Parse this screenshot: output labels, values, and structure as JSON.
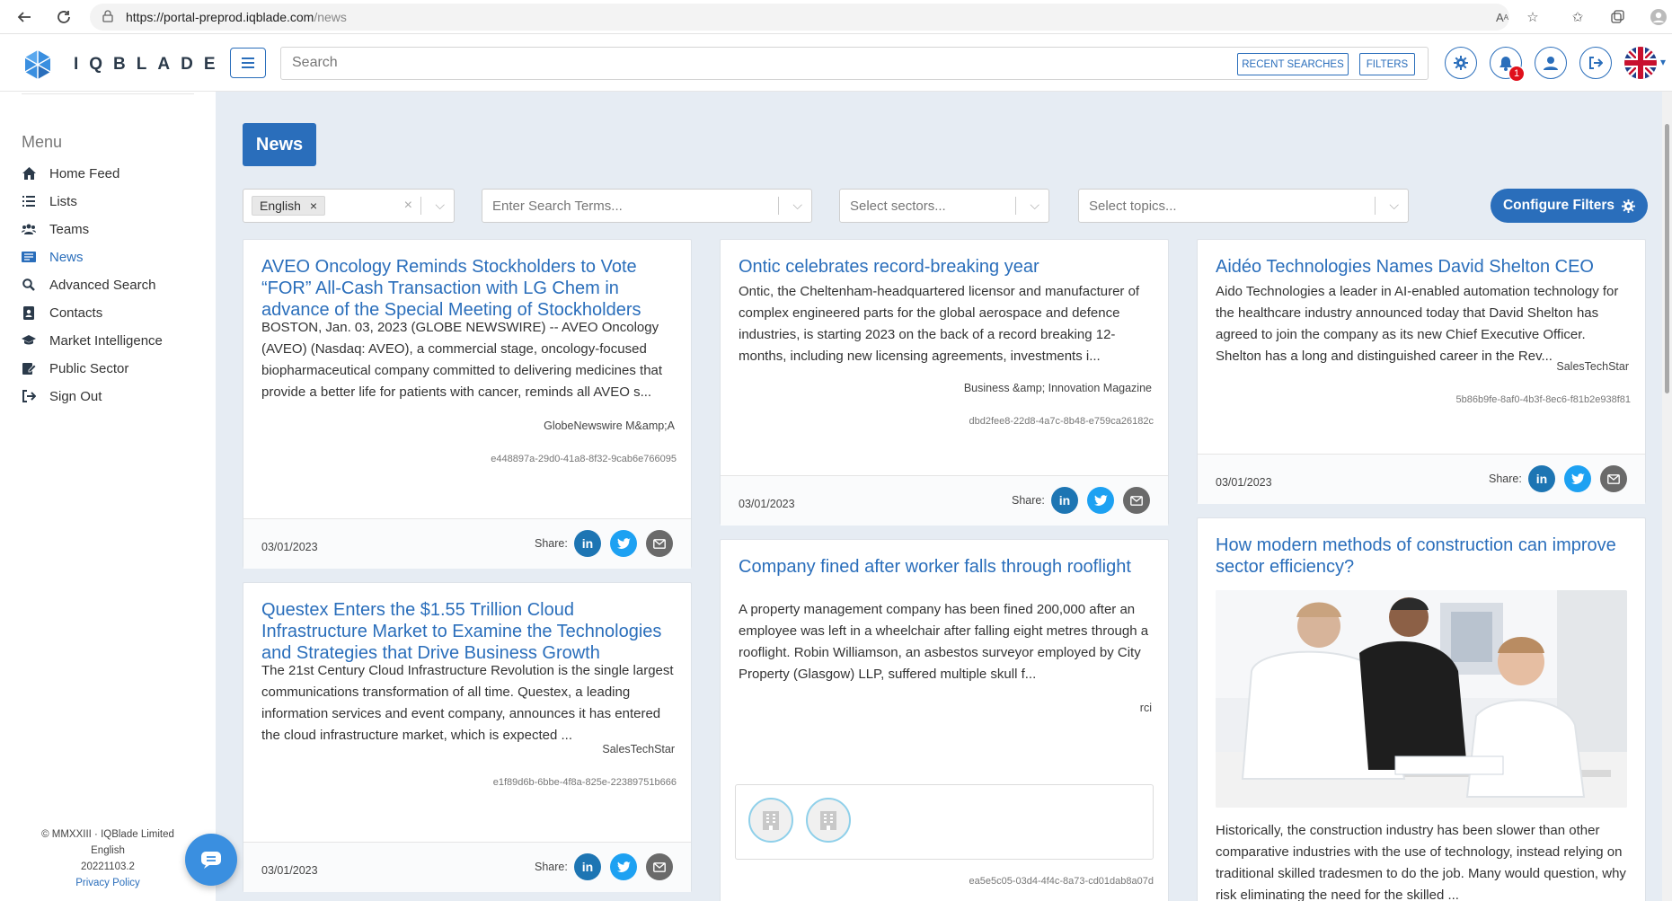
{
  "browser": {
    "url_host": "https://portal-preprod.iqblade.com",
    "url_path": "/news"
  },
  "header": {
    "logo_text": "IQBLADE",
    "search_placeholder": "Search",
    "recent_searches_label": "RECENT SEARCHES",
    "filters_label": "FILTERS",
    "notification_count": "1",
    "icons": [
      "settings-icon",
      "bell-icon",
      "user-icon",
      "sign-out-icon",
      "uk-flag-icon"
    ]
  },
  "sidebar": {
    "menu_heading": "Menu",
    "items": [
      {
        "label": "Home Feed",
        "icon": "home-icon"
      },
      {
        "label": "Lists",
        "icon": "list-icon"
      },
      {
        "label": "Teams",
        "icon": "users-icon"
      },
      {
        "label": "News",
        "icon": "news-icon",
        "active": true
      },
      {
        "label": "Advanced Search",
        "icon": "search-icon"
      },
      {
        "label": "Contacts",
        "icon": "contact-book-icon"
      },
      {
        "label": "Market Intelligence",
        "icon": "graduation-cap-icon"
      },
      {
        "label": "Public Sector",
        "icon": "edit-doc-icon"
      },
      {
        "label": "Sign Out",
        "icon": "sign-out-icon"
      }
    ],
    "footer": {
      "copyright": "© MMXXIII · IQBlade Limited",
      "language": "English",
      "version": "20221103.2",
      "privacy": "Privacy Policy"
    }
  },
  "main": {
    "title": "News",
    "filters": {
      "language_tag": "English",
      "search_terms_placeholder": "Enter Search Terms...",
      "sectors_placeholder": "Select sectors...",
      "topics_placeholder": "Select topics..."
    },
    "configure_filters_label": "Configure Filters",
    "share_label": "Share:",
    "articles": [
      {
        "title": "AVEO Oncology Reminds Stockholders to Vote “FOR” All-Cash Transaction with LG Chem in advance of the Special Meeting of Stockholders",
        "body": "BOSTON, Jan. 03, 2023 (GLOBE NEWSWIRE) -- AVEO Oncology (AVEO) (Nasdaq: AVEO), a commercial stage, oncology-focused biopharmaceutical company committed to delivering medicines that provide a better life for patients with cancer, reminds all AVEO s...",
        "source": "GlobeNewswire M&amp;A",
        "id": "e448897a-29d0-41a8-8f32-9cab6e766095",
        "date": "03/01/2023"
      },
      {
        "title": "Questex Enters the $1.55 Trillion Cloud Infrastructure Market to Examine the Technologies and Strategies that Drive Business Growth",
        "body": "The 21st Century Cloud Infrastructure Revolution is the single largest communications transformation of all time. Questex, a leading information services and event company, announces it has entered the cloud infrastructure market, which is expected ...",
        "source": "SalesTechStar",
        "id": "e1f89d6b-6bbe-4f8a-825e-22389751b666",
        "date": "03/01/2023"
      },
      {
        "title": "Ontic celebrates record-breaking year",
        "body": "Ontic, the Cheltenham-headquartered licensor and manufacturer of complex engineered parts for the global aerospace and defence industries, is starting 2023 on the back of a record breaking 12-months, including new licensing agreements, investments i...",
        "source": "Business &amp; Innovation Magazine",
        "id": "dbd2fee8-22d8-4a7c-8b48-e759ca26182c",
        "date": "03/01/2023"
      },
      {
        "title": "Company fined after worker falls through rooflight",
        "body": "A property management company has been fined 200,000 after an employee was left in a wheelchair after falling eight metres through a rooflight. Robin Williamson, an asbestos surveyor employed by City Property (Glasgow) LLP, suffered multiple skull f...",
        "source": "rci",
        "id": "ea5e5c05-03d4-4f4c-8a73-cd01dab8a07d"
      },
      {
        "title": "Aidéo Technologies Names David Shelton CEO",
        "body": "Aido Technologies a leader in AI-enabled automation technology for the healthcare industry announced today that David Shelton has agreed to join the company as its new Chief Executive Officer. Shelton has a long and distinguished career in the Rev...",
        "source": "SalesTechStar",
        "id": "5b86b9fe-8af0-4b3f-8ec6-f81b2e938f81",
        "date": "03/01/2023"
      },
      {
        "title": "How modern methods of construction can improve sector efficiency?",
        "body": "Historically, the construction industry has been slower than other comparative industries with the use of technology, instead relying on traditional skilled tradesmen to do the job. Many would question, why risk eliminating the need for the skilled ..."
      }
    ]
  }
}
